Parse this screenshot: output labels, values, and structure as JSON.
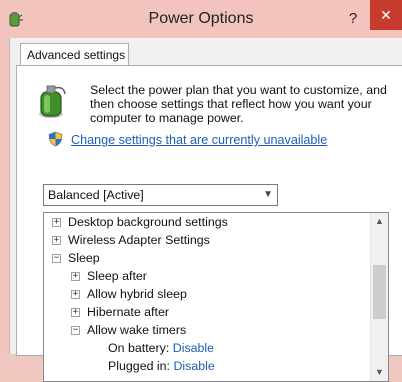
{
  "window": {
    "title": "Power Options",
    "help_label": "?",
    "close_label": "✕"
  },
  "tabs": [
    {
      "label": "Advanced settings",
      "active": true
    }
  ],
  "description": "Select the power plan that you want to customize, and then choose settings that reflect how you want your computer to manage power.",
  "change_link": "Change settings that are currently unavailable",
  "plan_select": {
    "value": "Balanced [Active]"
  },
  "tree": {
    "items": [
      {
        "label": "Desktop background settings",
        "toggle": "+",
        "level": 0
      },
      {
        "label": "Wireless Adapter Settings",
        "toggle": "+",
        "level": 0
      },
      {
        "label": "Sleep",
        "toggle": "−",
        "level": 0
      },
      {
        "label": "Sleep after",
        "toggle": "+",
        "level": 1
      },
      {
        "label": "Allow hybrid sleep",
        "toggle": "+",
        "level": 1
      },
      {
        "label": "Hibernate after",
        "toggle": "+",
        "level": 1
      },
      {
        "label": "Allow wake timers",
        "toggle": "−",
        "level": 1
      },
      {
        "label": "On battery:",
        "value": "Disable",
        "level": 2
      },
      {
        "label": "Plugged in:",
        "value": "Disable",
        "level": 2
      }
    ]
  },
  "colors": {
    "accent_link": "#1c5fb4",
    "close_button": "#c73b2f"
  },
  "icons": {
    "title": "power-plan-icon",
    "shield": "uac-shield-icon"
  }
}
